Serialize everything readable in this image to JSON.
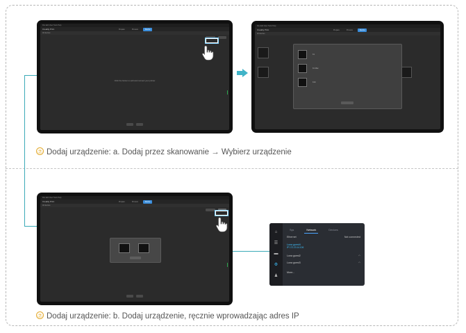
{
  "captions": {
    "a": {
      "number": "⑦",
      "text": "Dodaj urządzenie: a. Dodaj przez skanowanie → Wybierz urządzenie"
    },
    "b": {
      "number": "⑦",
      "text": "Dodaj urządzenie: b. Dodaj urządzenie, ręcznie wprowadzając adres IP"
    }
  },
  "app": {
    "title": "Creality Print",
    "menu": "File  Edit  View  Tools  Help",
    "tabs": [
      {
        "label": "Prepare"
      },
      {
        "label": "Preview"
      },
      {
        "label": "Device"
      }
    ],
    "toolbar_label": "All devices",
    "empty_message": "Click the button to add and connect your printer",
    "add_button": "Add"
  },
  "scan_modal": {
    "devices": [
      {
        "name": "K1"
      },
      {
        "name": "K1 Max"
      },
      {
        "name": "K1C"
      }
    ]
  },
  "lan_panel": {
    "tabs": [
      {
        "label": "Sys"
      },
      {
        "label": "Network"
      },
      {
        "label": "Devices"
      }
    ],
    "ethernet_label": "Ethernet",
    "connected_label": "Not connected",
    "devices": [
      {
        "name": "Luna guest4",
        "ip": "IP 172.23.14.106"
      },
      {
        "name": "Luna guest2"
      },
      {
        "name": "Luna guest3"
      }
    ],
    "more_label": "More..."
  },
  "colors": {
    "accent": "#3aaab7",
    "caption_number": "#e3a92a",
    "device_tab": "#3a8ddb",
    "selected_device": "#3ec2ff"
  }
}
